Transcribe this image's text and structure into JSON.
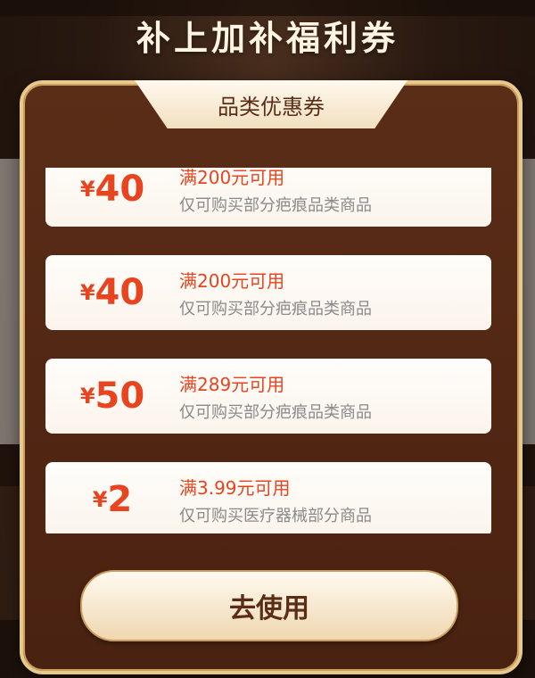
{
  "page": {
    "headline": "补上加补福利券"
  },
  "modal": {
    "tab_title": "品类优惠券",
    "coupons": [
      {
        "currency": "¥",
        "amount": "40",
        "condition": "满200元可用",
        "scope": "仅可购买部分疤痕品类商品"
      },
      {
        "currency": "¥",
        "amount": "40",
        "condition": "满200元可用",
        "scope": "仅可购买部分疤痕品类商品"
      },
      {
        "currency": "¥",
        "amount": "50",
        "condition": "满289元可用",
        "scope": "仅可购买部分疤痕品类商品"
      },
      {
        "currency": "¥",
        "amount": "2",
        "condition": "满3.99元可用",
        "scope": "仅可购买医疗器械部分商品"
      }
    ],
    "use_button_label": "去使用"
  },
  "colors": {
    "accent_red": "#e8441f",
    "modal_brown": "#5a2d17",
    "gold_border": "#e7c98d"
  }
}
